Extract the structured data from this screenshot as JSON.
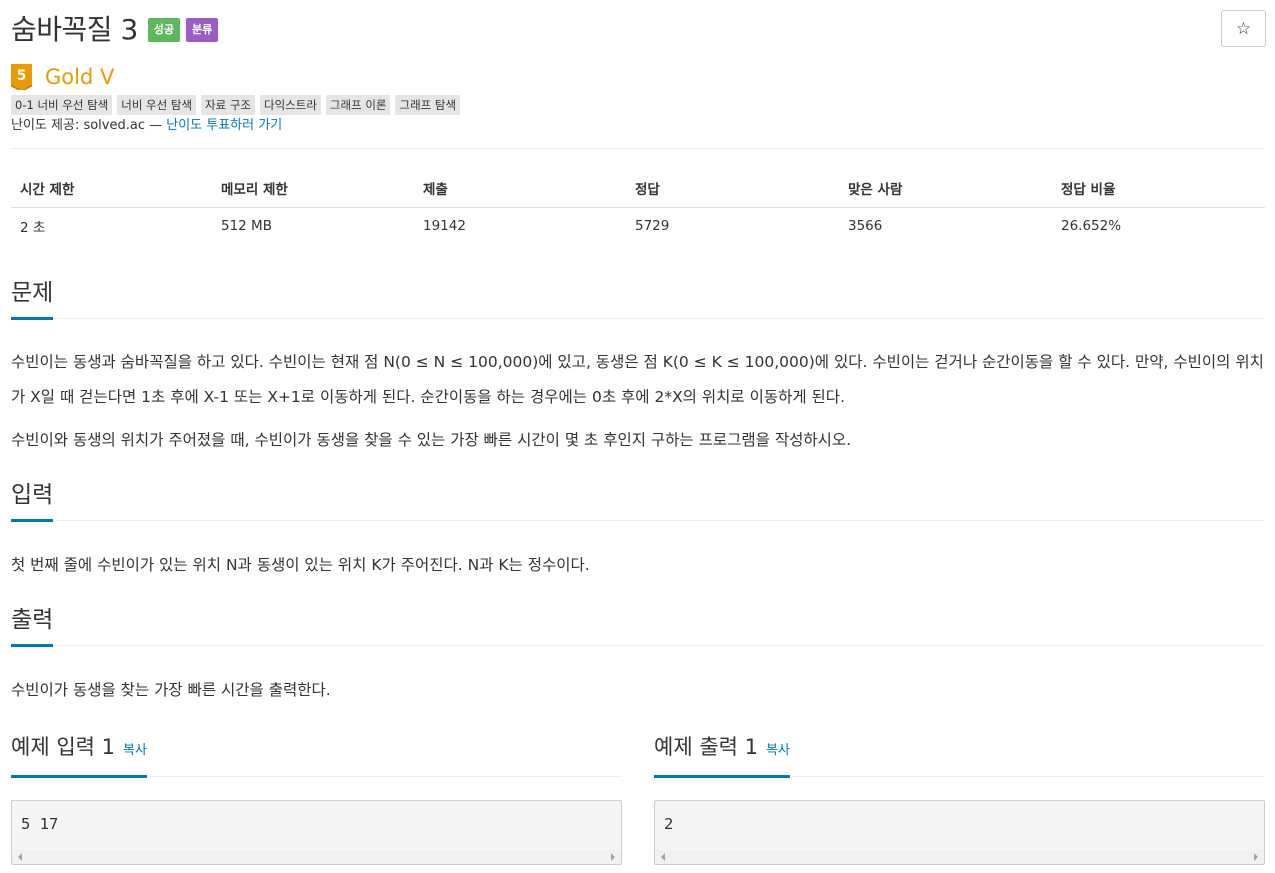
{
  "header": {
    "title": "숨바꼭질 3",
    "badges": [
      "성공",
      "분류"
    ],
    "star_icon": "☆"
  },
  "tier": {
    "level": "5",
    "name": "Gold V",
    "color": "#ec9a00"
  },
  "tags": [
    "0-1 너비 우선 탐색",
    "너비 우선 탐색",
    "자료 구조",
    "다익스트라",
    "그래프 이론",
    "그래프 탐색"
  ],
  "provider": {
    "prefix": "난이도 제공: solved.ac —",
    "link": "난이도 투표하러 가기"
  },
  "info": {
    "headers": [
      "시간 제한",
      "메모리 제한",
      "제출",
      "정답",
      "맞은 사람",
      "정답 비율"
    ],
    "values": [
      "2 초",
      "512 MB",
      "19142",
      "5729",
      "3566",
      "26.652%"
    ]
  },
  "sections": {
    "problem": {
      "title": "문제",
      "paragraphs": [
        "수빈이는 동생과 숨바꼭질을 하고 있다. 수빈이는 현재 점 N(0 ≤ N ≤ 100,000)에 있고, 동생은 점 K(0 ≤ K ≤ 100,000)에 있다. 수빈이는 걷거나 순간이동을 할 수 있다. 만약, 수빈이의 위치가 X일 때 걷는다면 1초 후에 X-1 또는 X+1로 이동하게 된다. 순간이동을 하는 경우에는 0초 후에 2*X의 위치로 이동하게 된다.",
        "수빈이와 동생의 위치가 주어졌을 때, 수빈이가 동생을 찾을 수 있는 가장 빠른 시간이 몇 초 후인지 구하는 프로그램을 작성하시오."
      ]
    },
    "input": {
      "title": "입력",
      "text": "첫 번째 줄에 수빈이가 있는 위치 N과 동생이 있는 위치 K가 주어진다. N과 K는 정수이다."
    },
    "output": {
      "title": "출력",
      "text": "수빈이가 동생을 찾는 가장 빠른 시간을 출력한다."
    }
  },
  "samples": {
    "input": {
      "title": "예제 입력 1",
      "copy": "복사",
      "content": "5 17"
    },
    "output": {
      "title": "예제 출력 1",
      "copy": "복사",
      "content": "2"
    }
  },
  "colors": {
    "accent": "#0076c0",
    "success": "#5cb85c",
    "classify": "#9b5cc5",
    "gold": "#ec9a00"
  }
}
